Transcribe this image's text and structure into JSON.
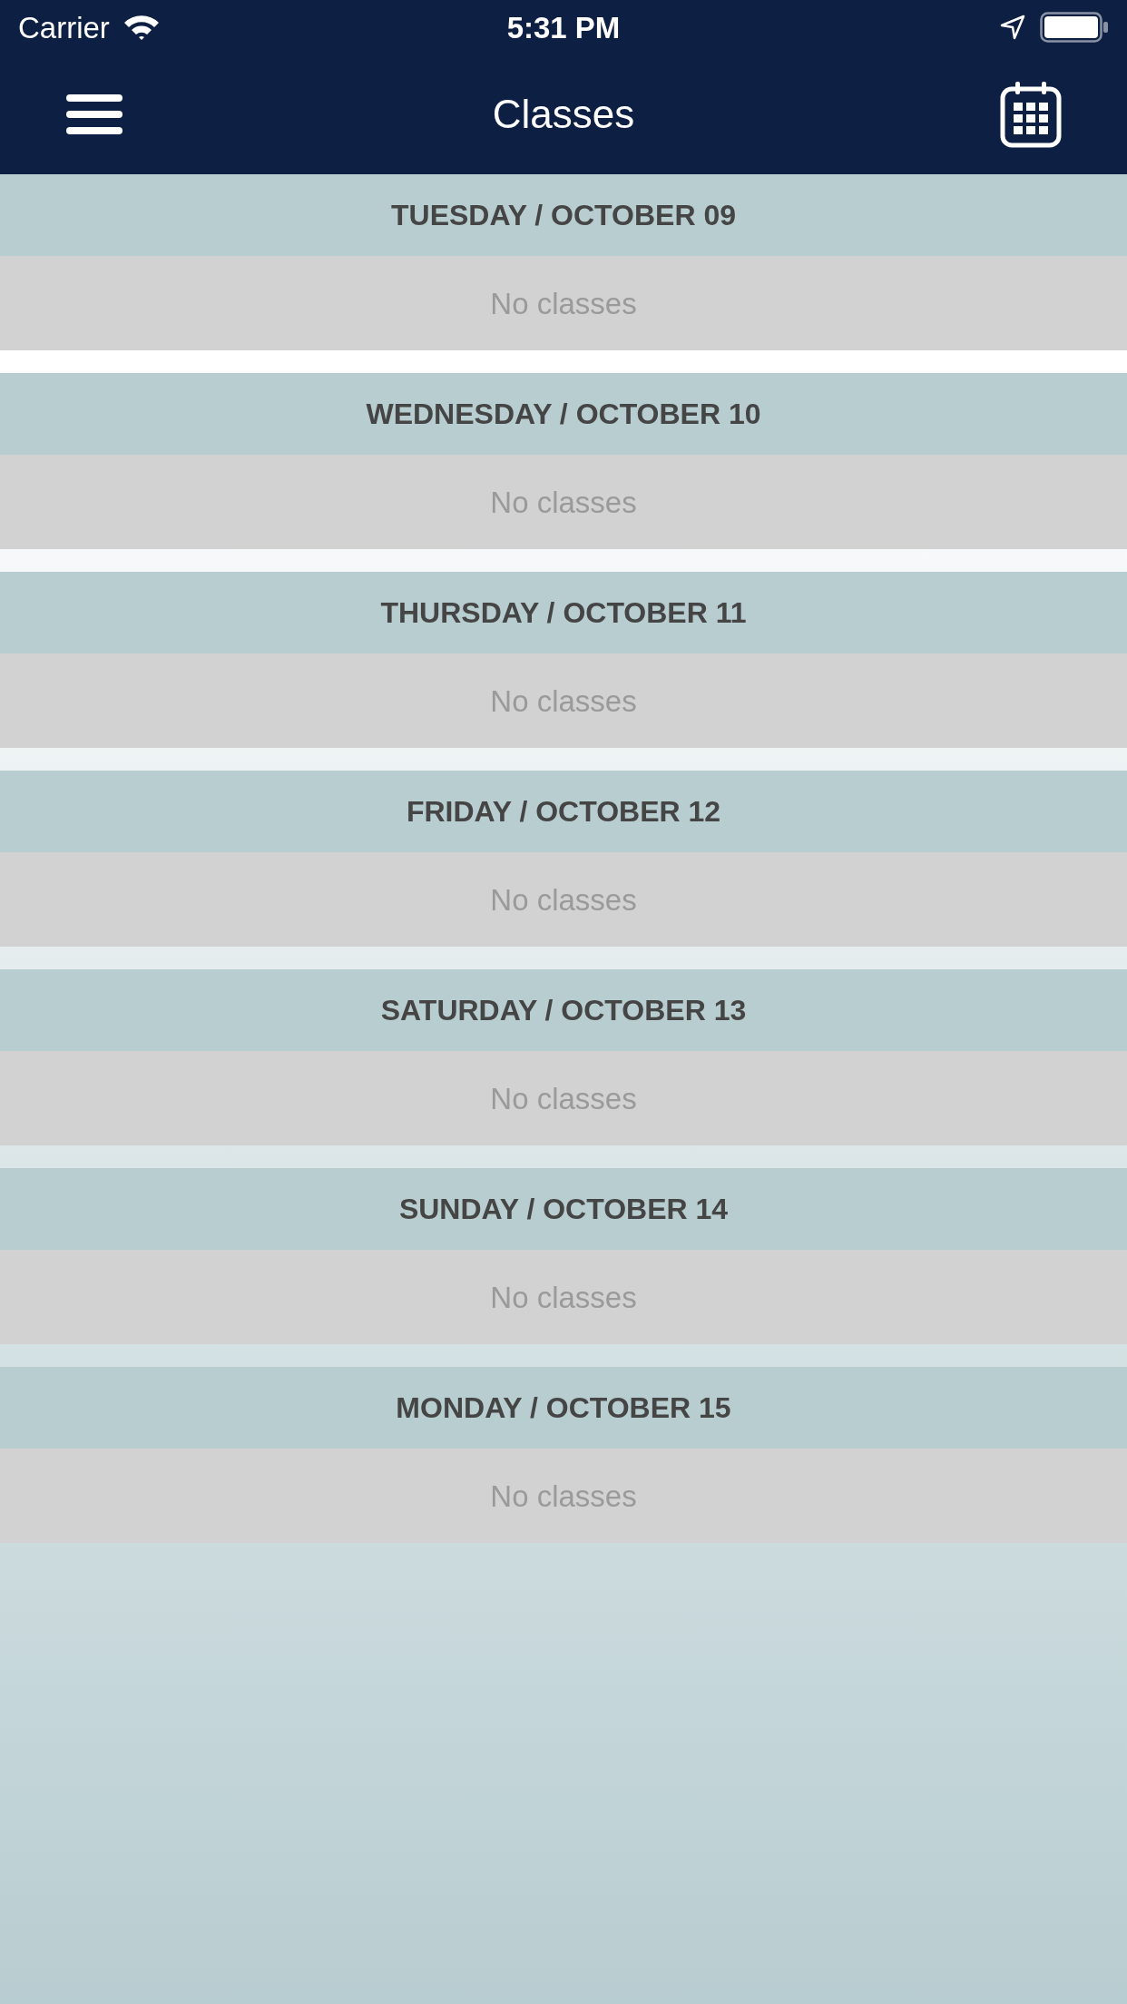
{
  "status_bar": {
    "carrier": "Carrier",
    "time": "5:31 PM"
  },
  "nav_bar": {
    "title": "Classes"
  },
  "days": [
    {
      "heading": "TUESDAY / OCTOBER 09",
      "message": "No classes"
    },
    {
      "heading": "WEDNESDAY / OCTOBER 10",
      "message": "No classes"
    },
    {
      "heading": "THURSDAY / OCTOBER 11",
      "message": "No classes"
    },
    {
      "heading": "FRIDAY / OCTOBER 12",
      "message": "No classes"
    },
    {
      "heading": "SATURDAY / OCTOBER 13",
      "message": "No classes"
    },
    {
      "heading": "SUNDAY / OCTOBER 14",
      "message": "No classes"
    },
    {
      "heading": "MONDAY / OCTOBER 15",
      "message": "No classes"
    }
  ]
}
